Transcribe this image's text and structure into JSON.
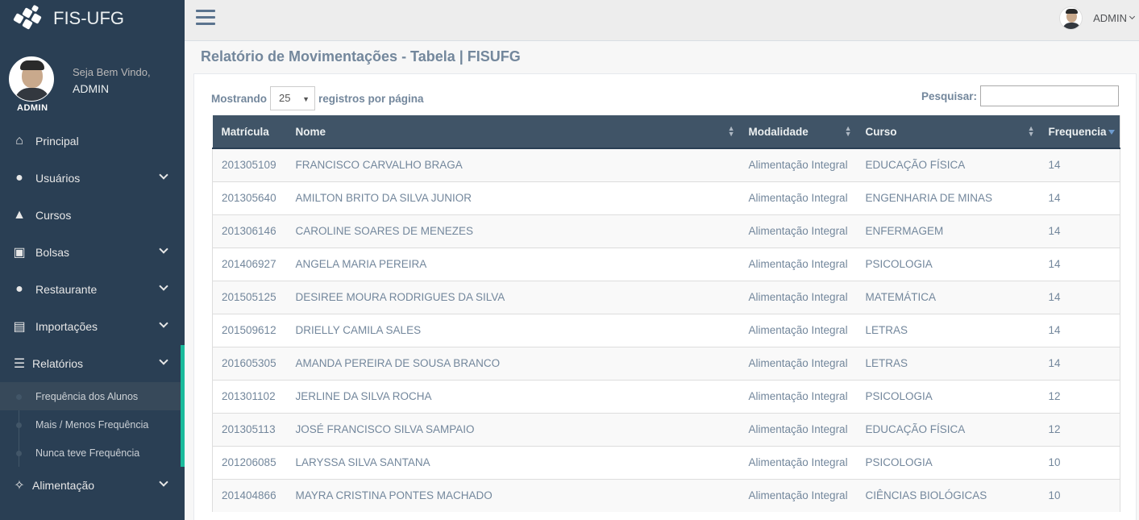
{
  "brand": {
    "title": "FIS-UFG"
  },
  "profile": {
    "welcome": "Seja Bem Vindo,",
    "name": "ADMIN",
    "badge": "ADMIN"
  },
  "menu": [
    {
      "label": "Principal",
      "icon": "home-icon"
    },
    {
      "label": "Usuários",
      "icon": "user-icon"
    },
    {
      "label": "Cursos",
      "icon": "graduation-cap-icon"
    },
    {
      "label": "Bolsas",
      "icon": "briefcase-icon"
    },
    {
      "label": "Restaurante",
      "icon": "user-icon"
    },
    {
      "label": "Importações",
      "icon": "file-icon"
    },
    {
      "label": "Relatórios",
      "icon": "list-icon"
    },
    {
      "label": "Alimentação",
      "icon": "cutlery-icon"
    }
  ],
  "submenu": [
    {
      "label": "Frequência dos Alunos"
    },
    {
      "label": "Mais / Menos Frequência"
    },
    {
      "label": "Nunca teve Frequência"
    }
  ],
  "topnav": {
    "user": "ADMIN"
  },
  "page": {
    "title": "Relatório de Movimentações - Tabela | FISUFG"
  },
  "controls": {
    "showing_label": "Mostrando",
    "page_size": "25",
    "per_page_label": "registros por página",
    "search_label": "Pesquisar:",
    "search_value": ""
  },
  "table": {
    "headers": [
      "Matrícula",
      "Nome",
      "Modalidade",
      "Curso",
      "Frequencia"
    ],
    "rows": [
      [
        "201305109",
        "FRANCISCO CARVALHO BRAGA",
        "Alimentação Integral",
        "EDUCAÇÃO FÍSICA",
        "14"
      ],
      [
        "201305640",
        "AMILTON BRITO DA SILVA JUNIOR",
        "Alimentação Integral",
        "ENGENHARIA DE MINAS",
        "14"
      ],
      [
        "201306146",
        "CAROLINE SOARES DE MENEZES",
        "Alimentação Integral",
        "ENFERMAGEM",
        "14"
      ],
      [
        "201406927",
        "ANGELA MARIA PEREIRA",
        "Alimentação Integral",
        "PSICOLOGIA",
        "14"
      ],
      [
        "201505125",
        "DESIREE MOURA RODRIGUES DA SILVA",
        "Alimentação Integral",
        "MATEMÁTICA",
        "14"
      ],
      [
        "201509612",
        "DRIELLY CAMILA SALES",
        "Alimentação Integral",
        "LETRAS",
        "14"
      ],
      [
        "201605305",
        "AMANDA PEREIRA DE SOUSA BRANCO",
        "Alimentação Integral",
        "LETRAS",
        "14"
      ],
      [
        "201301102",
        "JERLINE DA SILVA ROCHA",
        "Alimentação Integral",
        "PSICOLOGIA",
        "12"
      ],
      [
        "201305113",
        "JOSÉ FRANCISCO SILVA SAMPAIO",
        "Alimentação Integral",
        "EDUCAÇÃO FÍSICA",
        "12"
      ],
      [
        "201206085",
        "LARYSSA SILVA SANTANA",
        "Alimentação Integral",
        "PSICOLOGIA",
        "10"
      ],
      [
        "201404866",
        "MAYRA CRISTINA PONTES MACHADO",
        "Alimentação Integral",
        "CIÊNCIAS BIOLÓGICAS",
        "10"
      ]
    ]
  }
}
